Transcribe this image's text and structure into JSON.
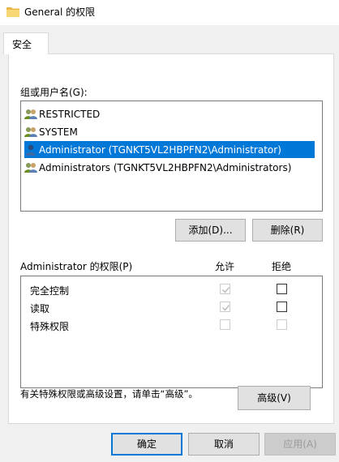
{
  "window": {
    "title": "General 的权限"
  },
  "tabs": [
    {
      "label": "安全"
    }
  ],
  "groups": {
    "label": "组或用户名(G):",
    "items": [
      {
        "name": "RESTRICTED",
        "icon": "users-group-icon",
        "selected": false
      },
      {
        "name": "SYSTEM",
        "icon": "users-group-icon",
        "selected": false
      },
      {
        "name": "Administrator (TGNKT5VL2HBPFN2\\Administrator)",
        "icon": "user-icon",
        "selected": true
      },
      {
        "name": "Administrators (TGNKT5VL2HBPFN2\\Administrators)",
        "icon": "users-group-icon",
        "selected": false
      }
    ]
  },
  "buttons": {
    "add": "添加(D)...",
    "remove": "删除(R)",
    "advanced": "高级(V)",
    "ok": "确定",
    "cancel": "取消",
    "apply": "应用(A)"
  },
  "permissions": {
    "label": "Administrator 的权限(P)",
    "allow_header": "允许",
    "deny_header": "拒绝",
    "rows": [
      {
        "name": "完全控制",
        "allow": true,
        "allow_disabled": true,
        "deny": false,
        "deny_disabled": false
      },
      {
        "name": "读取",
        "allow": true,
        "allow_disabled": true,
        "deny": false,
        "deny_disabled": false
      },
      {
        "name": "特殊权限",
        "allow": false,
        "allow_disabled": true,
        "deny": false,
        "deny_disabled": true
      }
    ]
  },
  "advanced_note": "有关特殊权限或高级设置，请单击“高级”。",
  "colors": {
    "selection": "#0078d7",
    "dialog_bg": "#f0f0f0",
    "folder": "#f8d775"
  }
}
